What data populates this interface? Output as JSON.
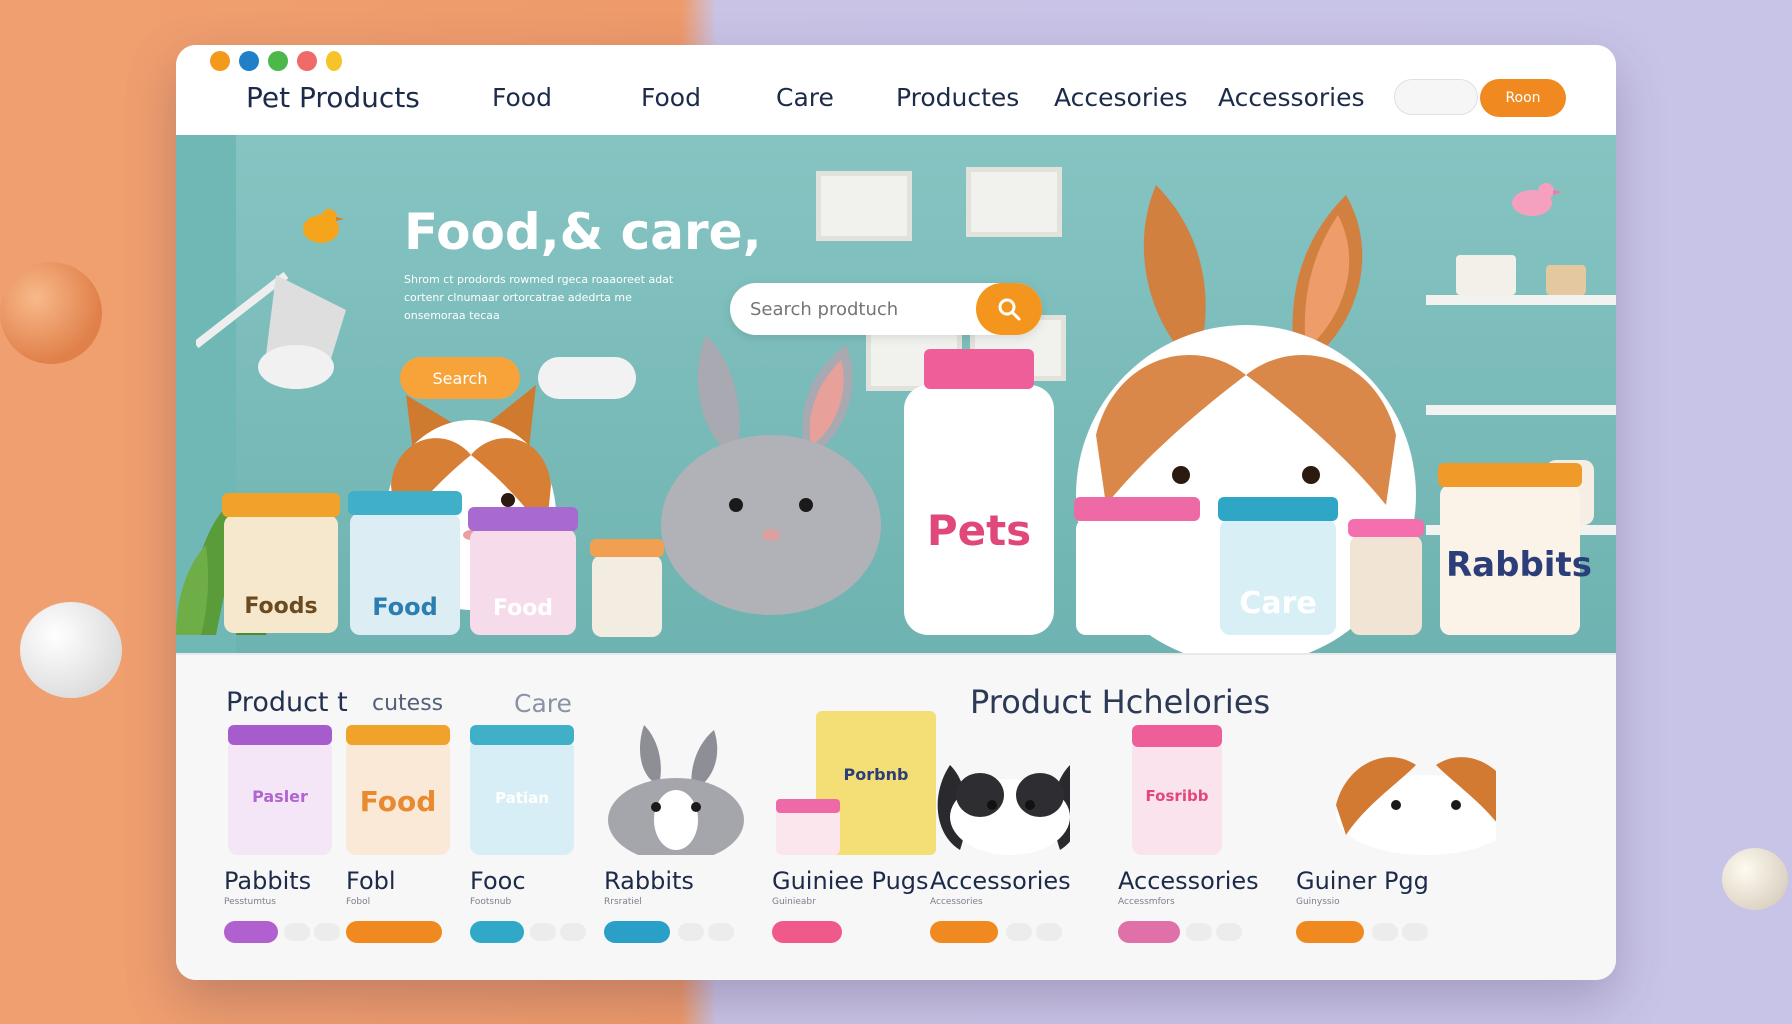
{
  "window": {
    "traffic_dots": [
      "#f39a1c",
      "#1f80c8",
      "#4cb84a",
      "#f06a6a",
      "#f6c32a"
    ]
  },
  "nav": {
    "brand": "Pet Products",
    "items": [
      "Food",
      "Food",
      "Care",
      "Productes",
      "Accesories",
      "Accessories"
    ],
    "login_label": "",
    "cta_label": "Roon"
  },
  "hero": {
    "title": "Food,& care,",
    "subtitle": "Shrom ct prodords rowmed rgeca roaaoreet adat cortenr clnumaar ortorcatrae adedrta me onsemoraa tecaa",
    "primary_button": "Search",
    "secondary_button": "",
    "search_placeholder": "Search prodtuch",
    "product_labels": {
      "jar1": "Foods",
      "jar2": "Food",
      "jar3": "Food",
      "jar4": "Pets",
      "jar5": "Care",
      "jar6": "Rabbits"
    }
  },
  "section": {
    "left_title": "Product t",
    "left_title_2": "cutess",
    "middle_title": "Care",
    "right_title": "Product Hchelories"
  },
  "products": [
    {
      "title": "Pabbits",
      "sub": "Pesstumtus",
      "tag_color": "#b160d0",
      "pack_label": "Pasler"
    },
    {
      "title": "Fobl",
      "sub": "Fobol",
      "tag_color": "#f08a20",
      "pack_label": "Food"
    },
    {
      "title": "Fooc",
      "sub": "Footsnub",
      "tag_color": "#30a8c8",
      "pack_label": "Patian"
    },
    {
      "title": "Rabbits",
      "sub": "Rrsratiel",
      "tag_color": "#2aa0c8",
      "pack_label": ""
    },
    {
      "title": "Guiniee Pugs",
      "sub": "Guinieabr",
      "tag_color": "#ef5a8a",
      "pack_label": "Porbnb"
    },
    {
      "title": "Accessories",
      "sub": "Accessories",
      "tag_color": "#f08a20",
      "pack_label": ""
    },
    {
      "title": "Accessories",
      "sub": "Accessmfors",
      "tag_color": "#e070a8",
      "pack_label": "Fosribb"
    },
    {
      "title": "Guiner Pgg",
      "sub": "Guinyssio",
      "tag_color": "#f08a20",
      "pack_label": ""
    }
  ]
}
